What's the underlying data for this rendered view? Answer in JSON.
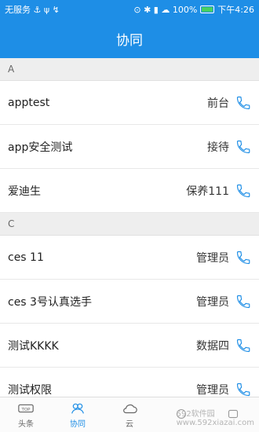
{
  "status": {
    "left": "无服务 ⚓ ψ ↯",
    "right": "⊙ ✱ ▮ ☁ 100%",
    "time": "下午4:26"
  },
  "title": "协同",
  "sections": [
    {
      "letter": "A",
      "rows": [
        {
          "name": "apptest",
          "role": "前台"
        },
        {
          "name": "app安全测试",
          "role": "接待"
        },
        {
          "name": "爱迪生",
          "role": "保养111"
        }
      ]
    },
    {
      "letter": "C",
      "rows": [
        {
          "name": "ces 11",
          "role": "管理员"
        },
        {
          "name": "ces 3号认真选手",
          "role": "管理员"
        },
        {
          "name": "测试KKKK",
          "role": "数据四"
        },
        {
          "name": "测试权限",
          "role": "管理员"
        }
      ]
    }
  ],
  "tabs": [
    {
      "label": "头条",
      "icon": "top-badge-icon",
      "active": false
    },
    {
      "label": "协同",
      "icon": "people-icon",
      "active": true
    },
    {
      "label": "云",
      "icon": "cloud-icon",
      "active": false
    },
    {
      "label": "",
      "icon": "placeholder-icon",
      "active": false
    },
    {
      "label": "",
      "icon": "placeholder-icon",
      "active": false
    }
  ],
  "watermark": {
    "brand": "592软件园",
    "url": "www.592xiazai.com"
  },
  "colors": {
    "accent": "#1e8ee6",
    "battery": "#48d060",
    "phone": "#1e8ee6"
  }
}
